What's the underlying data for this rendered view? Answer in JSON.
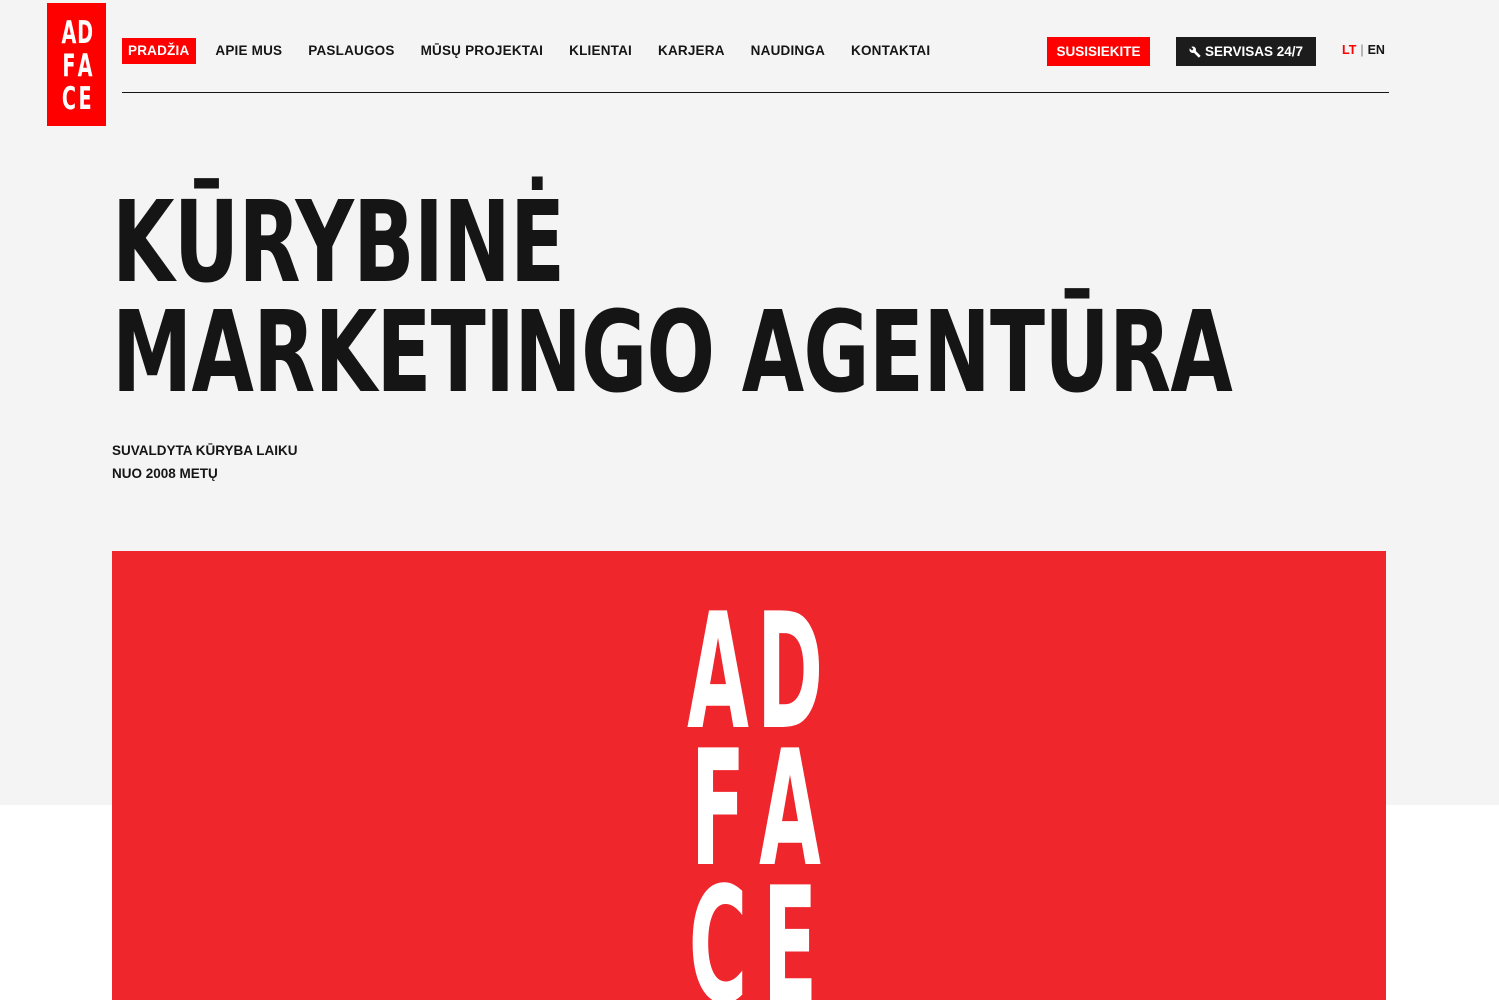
{
  "brand": {
    "logo_rows": [
      [
        "A",
        "D"
      ],
      [
        "F",
        "A"
      ],
      [
        "C",
        "E"
      ]
    ],
    "accent_color": "#ff0000",
    "banner_color": "#ef262c",
    "dark_color": "#1c1c1c"
  },
  "nav": {
    "items": [
      {
        "label": "PRADŽIA",
        "active": true
      },
      {
        "label": "APIE MUS",
        "active": false
      },
      {
        "label": "PASLAUGOS",
        "active": false
      },
      {
        "label": "MŪSŲ PROJEKTAI",
        "active": false
      },
      {
        "label": "KLIENTAI",
        "active": false
      },
      {
        "label": "KARJERA",
        "active": false
      },
      {
        "label": "NAUDINGA",
        "active": false
      },
      {
        "label": "KONTAKTAI",
        "active": false
      }
    ],
    "contact_label": "SUSISIEKITE",
    "service_label": "SERVISAS 24/7",
    "service_icon": "wrench-icon",
    "lang": {
      "current": "LT",
      "separator": "|",
      "other": "EN"
    }
  },
  "hero": {
    "title_line1": "KŪRYBINĖ",
    "title_line2": "MARKETINGO AGENTŪRA",
    "tagline_line1": "SUVALDYTA KŪRYBA LAIKU",
    "tagline_line2": "NUO 2008 METŲ"
  }
}
